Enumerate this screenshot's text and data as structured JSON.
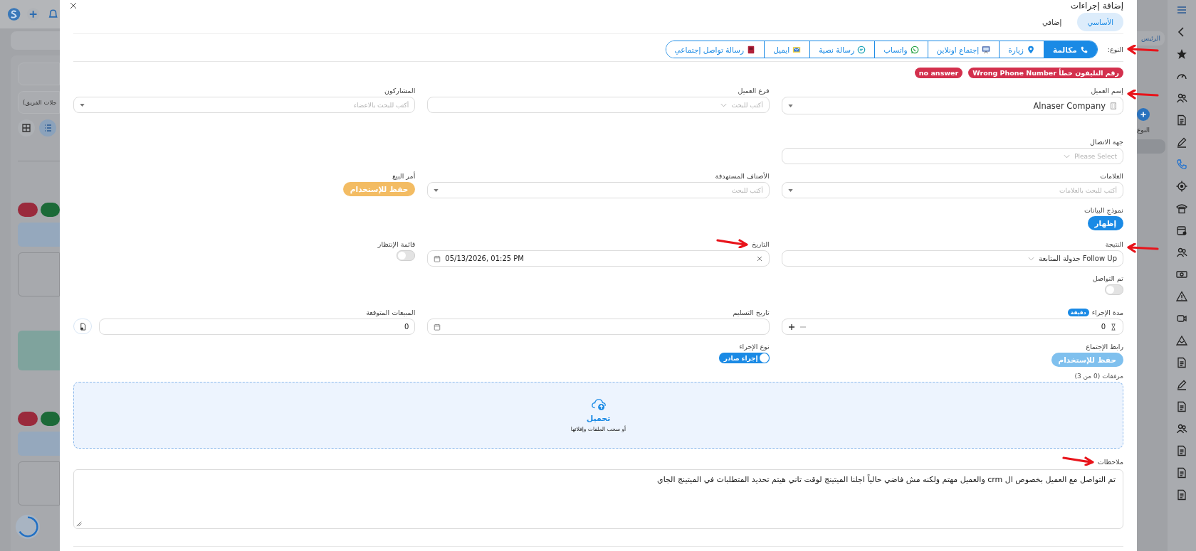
{
  "background_page": {
    "filter_label": "جلات الفريق)",
    "side_texts": [
      "الرئيس",
      "النوع"
    ]
  },
  "modal": {
    "title": "إضافة إجراءات",
    "tabs": [
      {
        "label": "الأساسي",
        "selected": true
      },
      {
        "label": "إضافي",
        "selected": false
      }
    ]
  },
  "action_type": {
    "label": "النوع:",
    "marked": true,
    "options": [
      {
        "kind": "call",
        "label": "مكالمة",
        "selected": true
      },
      {
        "kind": "visit",
        "label": "زيارة",
        "selected": false
      },
      {
        "kind": "online_meeting",
        "label": "إجتماع اونلاين",
        "selected": false
      },
      {
        "kind": "whatsapp",
        "label": "واتساب",
        "selected": false
      },
      {
        "kind": "sms",
        "label": "رسالة نصية",
        "selected": false
      },
      {
        "kind": "email",
        "label": "ايميل",
        "selected": false
      },
      {
        "kind": "social",
        "label": "رسالة تواصل إجتماعي",
        "selected": false
      }
    ]
  },
  "tags": [
    {
      "label": "رقم التليفون خطأ Wrong Phone Number"
    },
    {
      "label": "no answer"
    }
  ],
  "form_rows": [
    {
      "cells": [
        {
          "kind": "record_select",
          "label": "إسم العميل",
          "value": "Alnaser Company",
          "marked": true
        },
        {
          "kind": "dropdown",
          "label": "فرع العميل",
          "placeholder": "أكتب للبحث"
        },
        {
          "kind": "search",
          "label": "المشاركون",
          "placeholder": "أكتب للبحث بالاعضاء"
        }
      ]
    },
    {
      "cells": [
        {
          "kind": "dropdown",
          "label": "جهة الاتصال",
          "placeholder": "Please Select"
        }
      ]
    },
    {
      "cells": [
        {
          "kind": "search",
          "label": "العلامات",
          "placeholder": "أكتب للبحث بالعلامات"
        },
        {
          "kind": "search",
          "label": "الأصناف المستهدفة",
          "placeholder": "أكتب للبحث"
        },
        {
          "kind": "button",
          "label": "أمر البيع",
          "button": "حفظ للإستخدام",
          "color": "#f3bc63"
        }
      ]
    },
    {
      "cells": [
        {
          "kind": "button",
          "label": "نموذج البيانات",
          "button": "إظهار",
          "color": "#1a8ae5"
        }
      ]
    },
    {
      "cells": [
        {
          "kind": "dropdown",
          "label": "النتيجة",
          "value": "Follow Up جدولة المتابعة",
          "marked": true
        },
        {
          "kind": "datetime",
          "label": "التاريخ",
          "value": "05/13/2026, 01:25 PM",
          "marked": true
        },
        {
          "kind": "toggle",
          "label": "قائمة الإنتظار",
          "on": false
        }
      ]
    },
    {
      "cells": [
        {
          "kind": "toggle",
          "label": "تم التواصل",
          "on": false
        }
      ]
    },
    {
      "cells": [
        {
          "kind": "duration",
          "label": "مدة الإجراء",
          "badge": "دقيقة",
          "value": "0"
        },
        {
          "kind": "date",
          "label": "تاريخ التسليم"
        },
        {
          "kind": "number",
          "label": "المبيعات المتوقعة",
          "value": "0"
        }
      ]
    },
    {
      "cells": [
        {
          "kind": "button",
          "label": "رابط الإجتماع",
          "button": "حفظ للإستخدام",
          "color": "#7fc0ee"
        },
        {
          "kind": "toggle",
          "label": "نوع الإجراء",
          "on": true,
          "text": "إجراء صادر"
        }
      ]
    }
  ],
  "attachments": {
    "label": "مرفقات (0 من 3)",
    "upload": "تحميل",
    "hint": "أو سحب الملفات وإفلاتها"
  },
  "notes": {
    "label": "ملاحظات",
    "marked": true,
    "value": "تم التواصل مع العميل بخصوص ال crm والعميل مهتم ولكنه مش فاضي حالياً اجلنا الميتينج لوقت تاني هيتم تحديد المتطلبات في الميتينج الجاي"
  }
}
